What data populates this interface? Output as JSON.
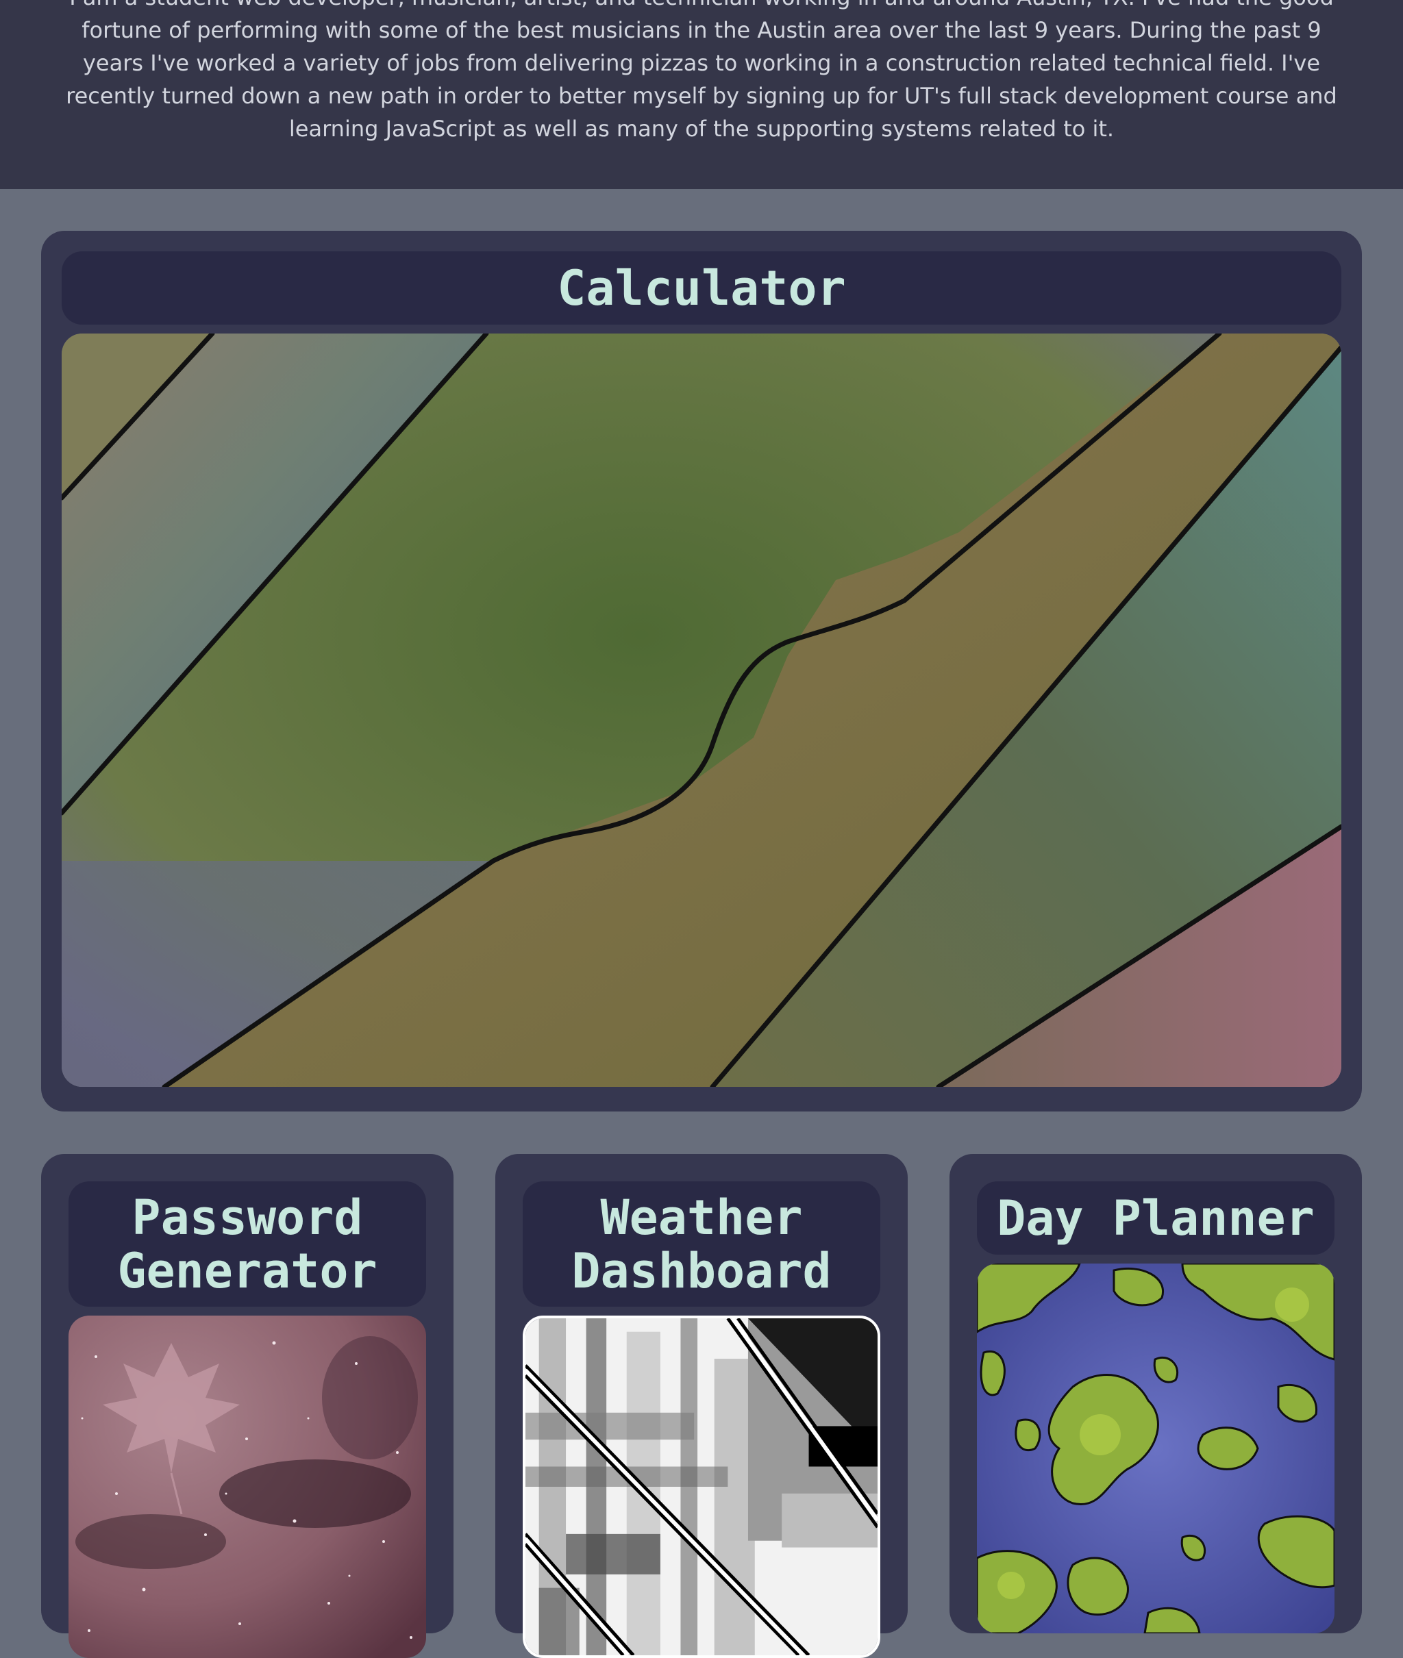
{
  "about": {
    "text": "I am a student web developer, musician, artist, and technician working in and around Austin, TX. I've had the good fortune of performing with some of the best musicians in the Austin area over the last 9 years. During the past 9 years I've worked a variety of jobs from delivering pizzas to working in a construction related technical field. I've recently turned down a new path in order to better myself by signing up for UT's full stack development course and learning JavaScript as well as many of the supporting systems related to it."
  },
  "projects": [
    {
      "title": "Calculator",
      "image": "abstract-wave-art"
    },
    {
      "title": "Password Generator",
      "image": "pink-leaf-galaxy-art"
    },
    {
      "title": "Weather Dashboard",
      "image": "grayscale-glitch-art"
    },
    {
      "title": "Day Planner",
      "image": "green-islands-on-blue-art"
    }
  ],
  "colors": {
    "page_background": "#686e7c",
    "header_background": "#353649",
    "card_background": "#363750",
    "title_background": "#292945",
    "title_text": "#c8e8de"
  }
}
